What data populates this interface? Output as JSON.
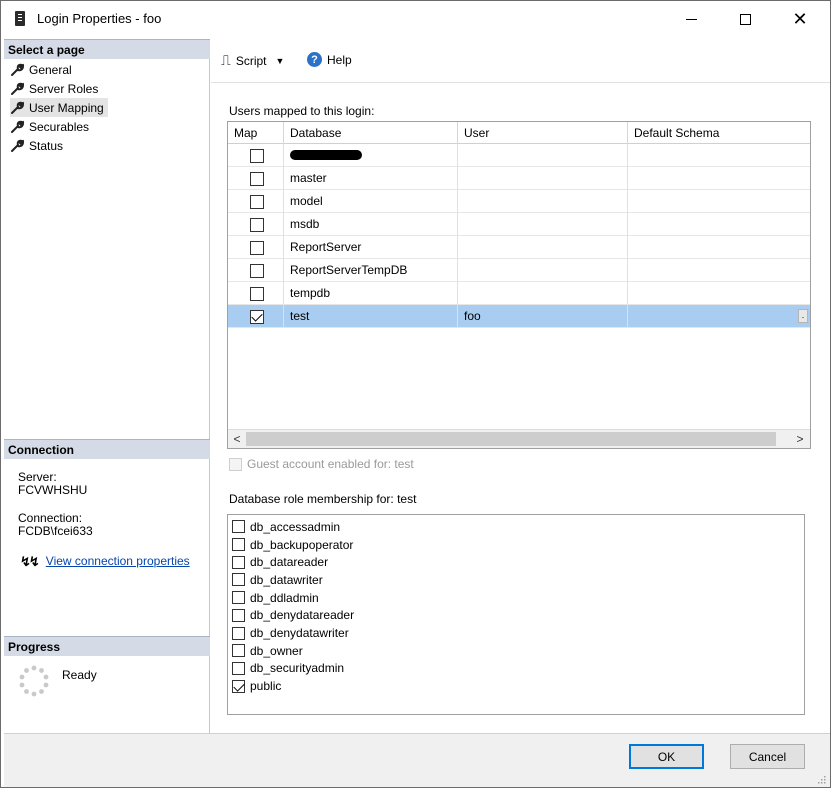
{
  "window": {
    "title": "Login Properties - foo"
  },
  "left": {
    "select_page_header": "Select a page",
    "pages": [
      {
        "label": "General",
        "icon": "wrench-icon"
      },
      {
        "label": "Server Roles",
        "icon": "wrench-icon"
      },
      {
        "label": "User Mapping",
        "icon": "wrench-icon"
      },
      {
        "label": "Securables",
        "icon": "wrench-icon"
      },
      {
        "label": "Status",
        "icon": "wrench-icon"
      }
    ],
    "connection_header": "Connection",
    "server_label": "Server:",
    "server_value": "FCVWHSHU",
    "connection_label": "Connection:",
    "connection_value": "FCDB\\fcei633",
    "view_connection_link": "View connection properties",
    "progress_header": "Progress",
    "progress_status": "Ready"
  },
  "toolbar": {
    "script_label": "Script",
    "help_label": "Help"
  },
  "users_mapped": {
    "label": "Users mapped to this login:",
    "columns": [
      "Map",
      "Database",
      "User",
      "Default Schema"
    ],
    "rows": [
      {
        "map": false,
        "database": "",
        "user": "",
        "schema": "",
        "redacted": true
      },
      {
        "map": false,
        "database": "master",
        "user": "",
        "schema": ""
      },
      {
        "map": false,
        "database": "model",
        "user": "",
        "schema": ""
      },
      {
        "map": false,
        "database": "msdb",
        "user": "",
        "schema": ""
      },
      {
        "map": false,
        "database": "ReportServer",
        "user": "",
        "schema": ""
      },
      {
        "map": false,
        "database": "ReportServerTempDB",
        "user": "",
        "schema": ""
      },
      {
        "map": false,
        "database": "tempdb",
        "user": "",
        "schema": ""
      },
      {
        "map": true,
        "database": "test",
        "user": "foo",
        "schema": "",
        "selected": true
      }
    ]
  },
  "guest_account_label": "Guest account enabled for: test",
  "role_membership": {
    "label": "Database role membership for: test",
    "roles": [
      {
        "name": "db_accessadmin",
        "checked": false
      },
      {
        "name": "db_backupoperator",
        "checked": false
      },
      {
        "name": "db_datareader",
        "checked": false
      },
      {
        "name": "db_datawriter",
        "checked": false
      },
      {
        "name": "db_ddladmin",
        "checked": false
      },
      {
        "name": "db_denydatareader",
        "checked": false
      },
      {
        "name": "db_denydatawriter",
        "checked": false
      },
      {
        "name": "db_owner",
        "checked": false
      },
      {
        "name": "db_securityadmin",
        "checked": false
      },
      {
        "name": "public",
        "checked": true
      }
    ]
  },
  "buttons": {
    "ok": "OK",
    "cancel": "Cancel"
  },
  "colors": {
    "selected_row": "#a8cdf0",
    "section_header": "#d4dbe6",
    "link": "#0645ad",
    "default_button_border": "#0078d7"
  }
}
